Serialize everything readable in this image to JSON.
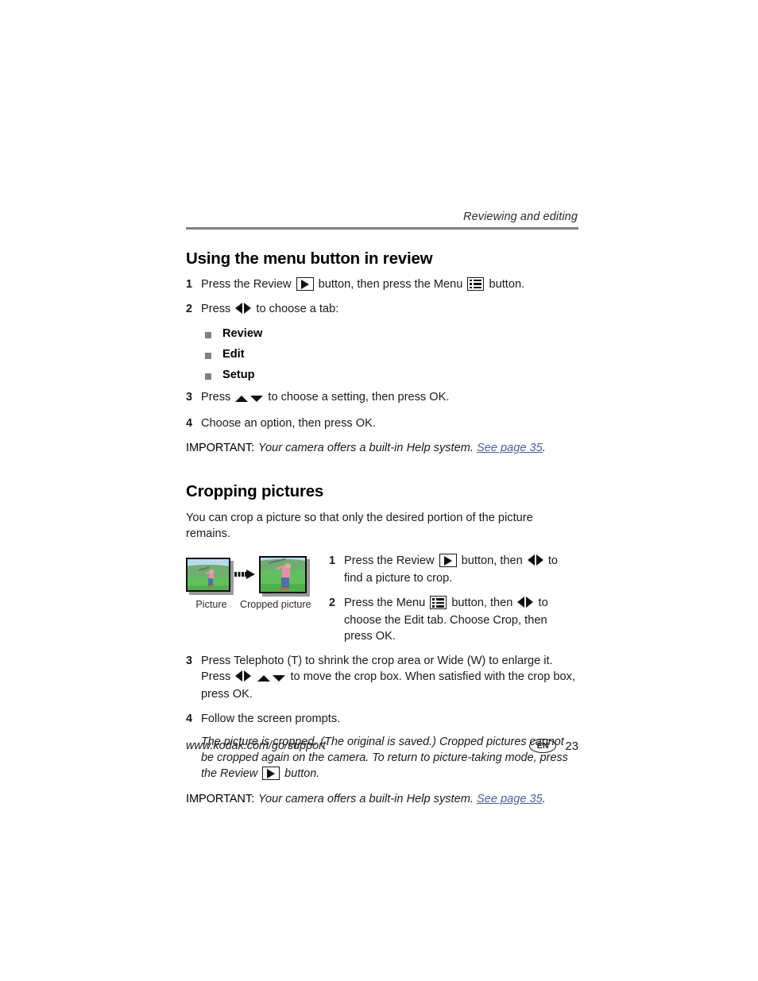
{
  "header": {
    "running_head": "Reviewing and editing"
  },
  "menu_section": {
    "title": "Using the menu button in review",
    "steps": [
      {
        "num": "1",
        "parts": [
          "Press the Review ",
          "review-icon",
          " button, then press the Menu ",
          "menu-icon",
          " button."
        ]
      },
      {
        "num": "2",
        "parts": [
          "Press ",
          "left-right-arrows-icon",
          " to choose a tab:"
        ]
      },
      {
        "num": "3",
        "parts": [
          "Press ",
          "up-down-arrows-icon",
          " to choose a setting, then press OK."
        ]
      },
      {
        "num": "4",
        "parts": [
          "Choose an option, then press OK."
        ]
      }
    ],
    "step1_text_a": "Press the Review ",
    "step1_text_b": " button, then press the Menu ",
    "step1_text_c": " button.",
    "step2_text_a": "Press ",
    "step2_text_b": " to choose a tab:",
    "step3_text_a": "Press ",
    "step3_text_b": " to choose a setting, then press OK.",
    "step4_text": "Choose an option, then press OK.",
    "tabs": [
      "Review",
      "Edit",
      "Setup"
    ],
    "important_label": "IMPORTANT:",
    "important_text": "Your camera offers a built-in Help system. ",
    "important_link": "See page 35",
    "important_period": "."
  },
  "crop_section": {
    "title": "Cropping pictures",
    "intro": "You can crop a picture so that only the desired portion of the picture remains.",
    "figure": {
      "caption_before": "Picture",
      "caption_after": "Cropped picture",
      "arrow": "transform-arrow-icon"
    },
    "steps": [
      {
        "num": "1"
      },
      {
        "num": "2"
      },
      {
        "num": "3"
      },
      {
        "num": "4"
      }
    ],
    "step1_text_a": "Press the Review ",
    "step1_text_b": " button, then ",
    "step1_text_c": " to find a picture to crop.",
    "step2_text_a": "Press the Menu ",
    "step2_text_b": " button, then ",
    "step2_text_c": " to choose the Edit tab. Choose Crop, then press OK.",
    "step3_text_a": "Press Telephoto (T) to shrink the crop area or Wide (W) to enlarge it. Press ",
    "step3_text_b": " ",
    "step3_text_c": " to move the crop box. When satisfied with the crop box, press OK.",
    "step4_text": "Follow the screen prompts.",
    "note_a": "The picture is cropped. (The original is saved.) Cropped pictures cannot be cropped again on the camera. To return to picture-taking mode, press the Review ",
    "note_b": " button.",
    "important_label": "IMPORTANT:",
    "important_text": "Your camera offers a built-in Help system. ",
    "important_link": "See page 35",
    "important_period": "."
  },
  "footer": {
    "url": "www.kodak.com/go/support",
    "language_badge": "EN",
    "page_number": "23"
  },
  "colors": {
    "link": "#4a5fa5",
    "rule": "#808080",
    "bullet": "#808080",
    "sky": "#b5dced",
    "grass": "#63c05f",
    "hill": "#6fae70",
    "shirt": "#e88fae",
    "jeans": "#4f6fa8"
  }
}
